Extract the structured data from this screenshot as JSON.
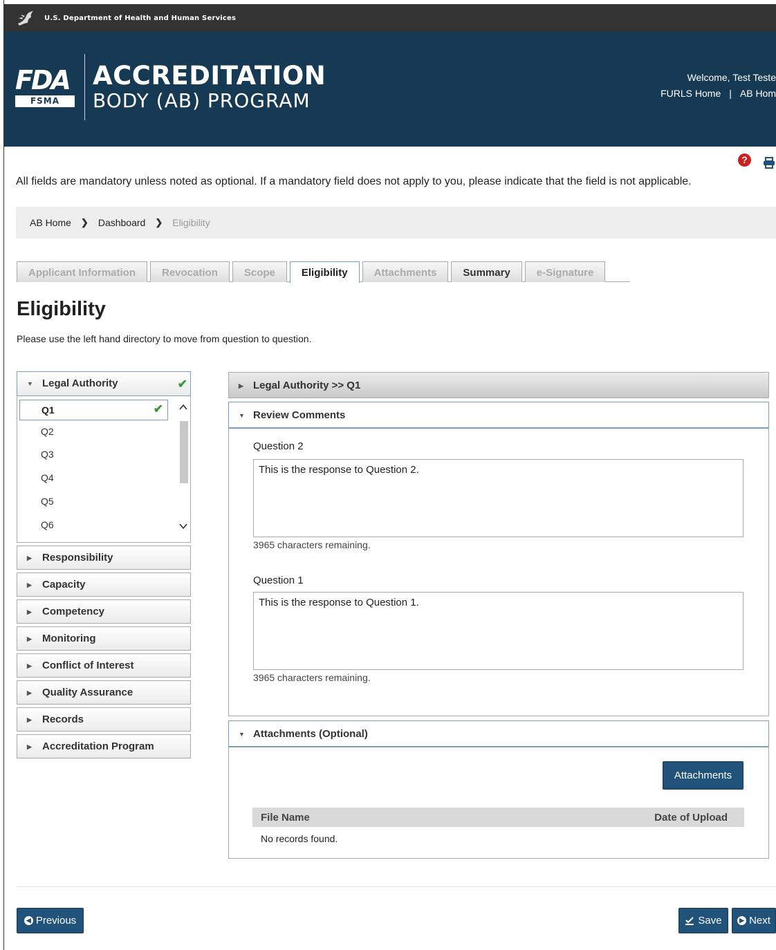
{
  "hhs_bar": {
    "text": "U.S. Department of Health and Human Services"
  },
  "banner": {
    "logo_text": "FDA",
    "logo_sub": "FSMA",
    "title_line1": "ACCREDITATION",
    "title_line2": "BODY (AB) PROGRAM",
    "welcome": "Welcome, Test Teste",
    "links": [
      "FURLS Home",
      "AB Hom"
    ],
    "link_separator": "|"
  },
  "utility": {
    "help_symbol": "?",
    "help_icon": "question-circle-icon",
    "print_icon": "print-icon",
    "help_color": "#d11f1f"
  },
  "mandatory_note": "All fields are mandatory unless noted as optional. If a mandatory field does not apply to you, please indicate that the field is not applicable.",
  "breadcrumb": {
    "items": [
      "AB Home",
      "Dashboard",
      "Eligibility"
    ],
    "separator": "❯"
  },
  "tabs": [
    {
      "label": "Applicant Information",
      "state": "disabled"
    },
    {
      "label": "Revocation",
      "state": "disabled"
    },
    {
      "label": "Scope",
      "state": "disabled"
    },
    {
      "label": "Eligibility",
      "state": "active"
    },
    {
      "label": "Attachments",
      "state": "disabled"
    },
    {
      "label": "Summary",
      "state": "enabled"
    },
    {
      "label": "e-Signature",
      "state": "disabled"
    }
  ],
  "page": {
    "title": "Eligibility",
    "subtitle": "Please use the left hand directory to move from question to question."
  },
  "directory": {
    "open_section": {
      "label": "Legal Authority",
      "complete": true
    },
    "questions": [
      "Q1",
      "Q2",
      "Q3",
      "Q4",
      "Q5",
      "Q6"
    ],
    "selected_question": "Q1",
    "sections": [
      "Responsibility",
      "Capacity",
      "Competency",
      "Monitoring",
      "Conflict of Interest",
      "Quality Assurance",
      "Records",
      "Accreditation Program"
    ],
    "check_symbol": "✔"
  },
  "main": {
    "legal_header": "Legal Authority >> Q1",
    "review_header": "Review Comments",
    "review_items": [
      {
        "label": "Question 2",
        "response": "This is the response to Question 2.",
        "remaining": "3965 characters remaining."
      },
      {
        "label": "Question 1",
        "response": "This is the response to Question 1.",
        "remaining": "3965 characters remaining."
      }
    ],
    "attachments_header": "Attachments (Optional)",
    "attachments_button": "Attachments",
    "file_table": {
      "columns": [
        "File Name",
        "Date of Upload"
      ],
      "empty_message": "No records found."
    }
  },
  "footer": {
    "previous": "Previous",
    "save": "Save",
    "next": "Next"
  },
  "colors": {
    "banner": "#163a53",
    "button": "#20527a",
    "hhs_bar": "#333333",
    "check": "#3a9a3a"
  }
}
